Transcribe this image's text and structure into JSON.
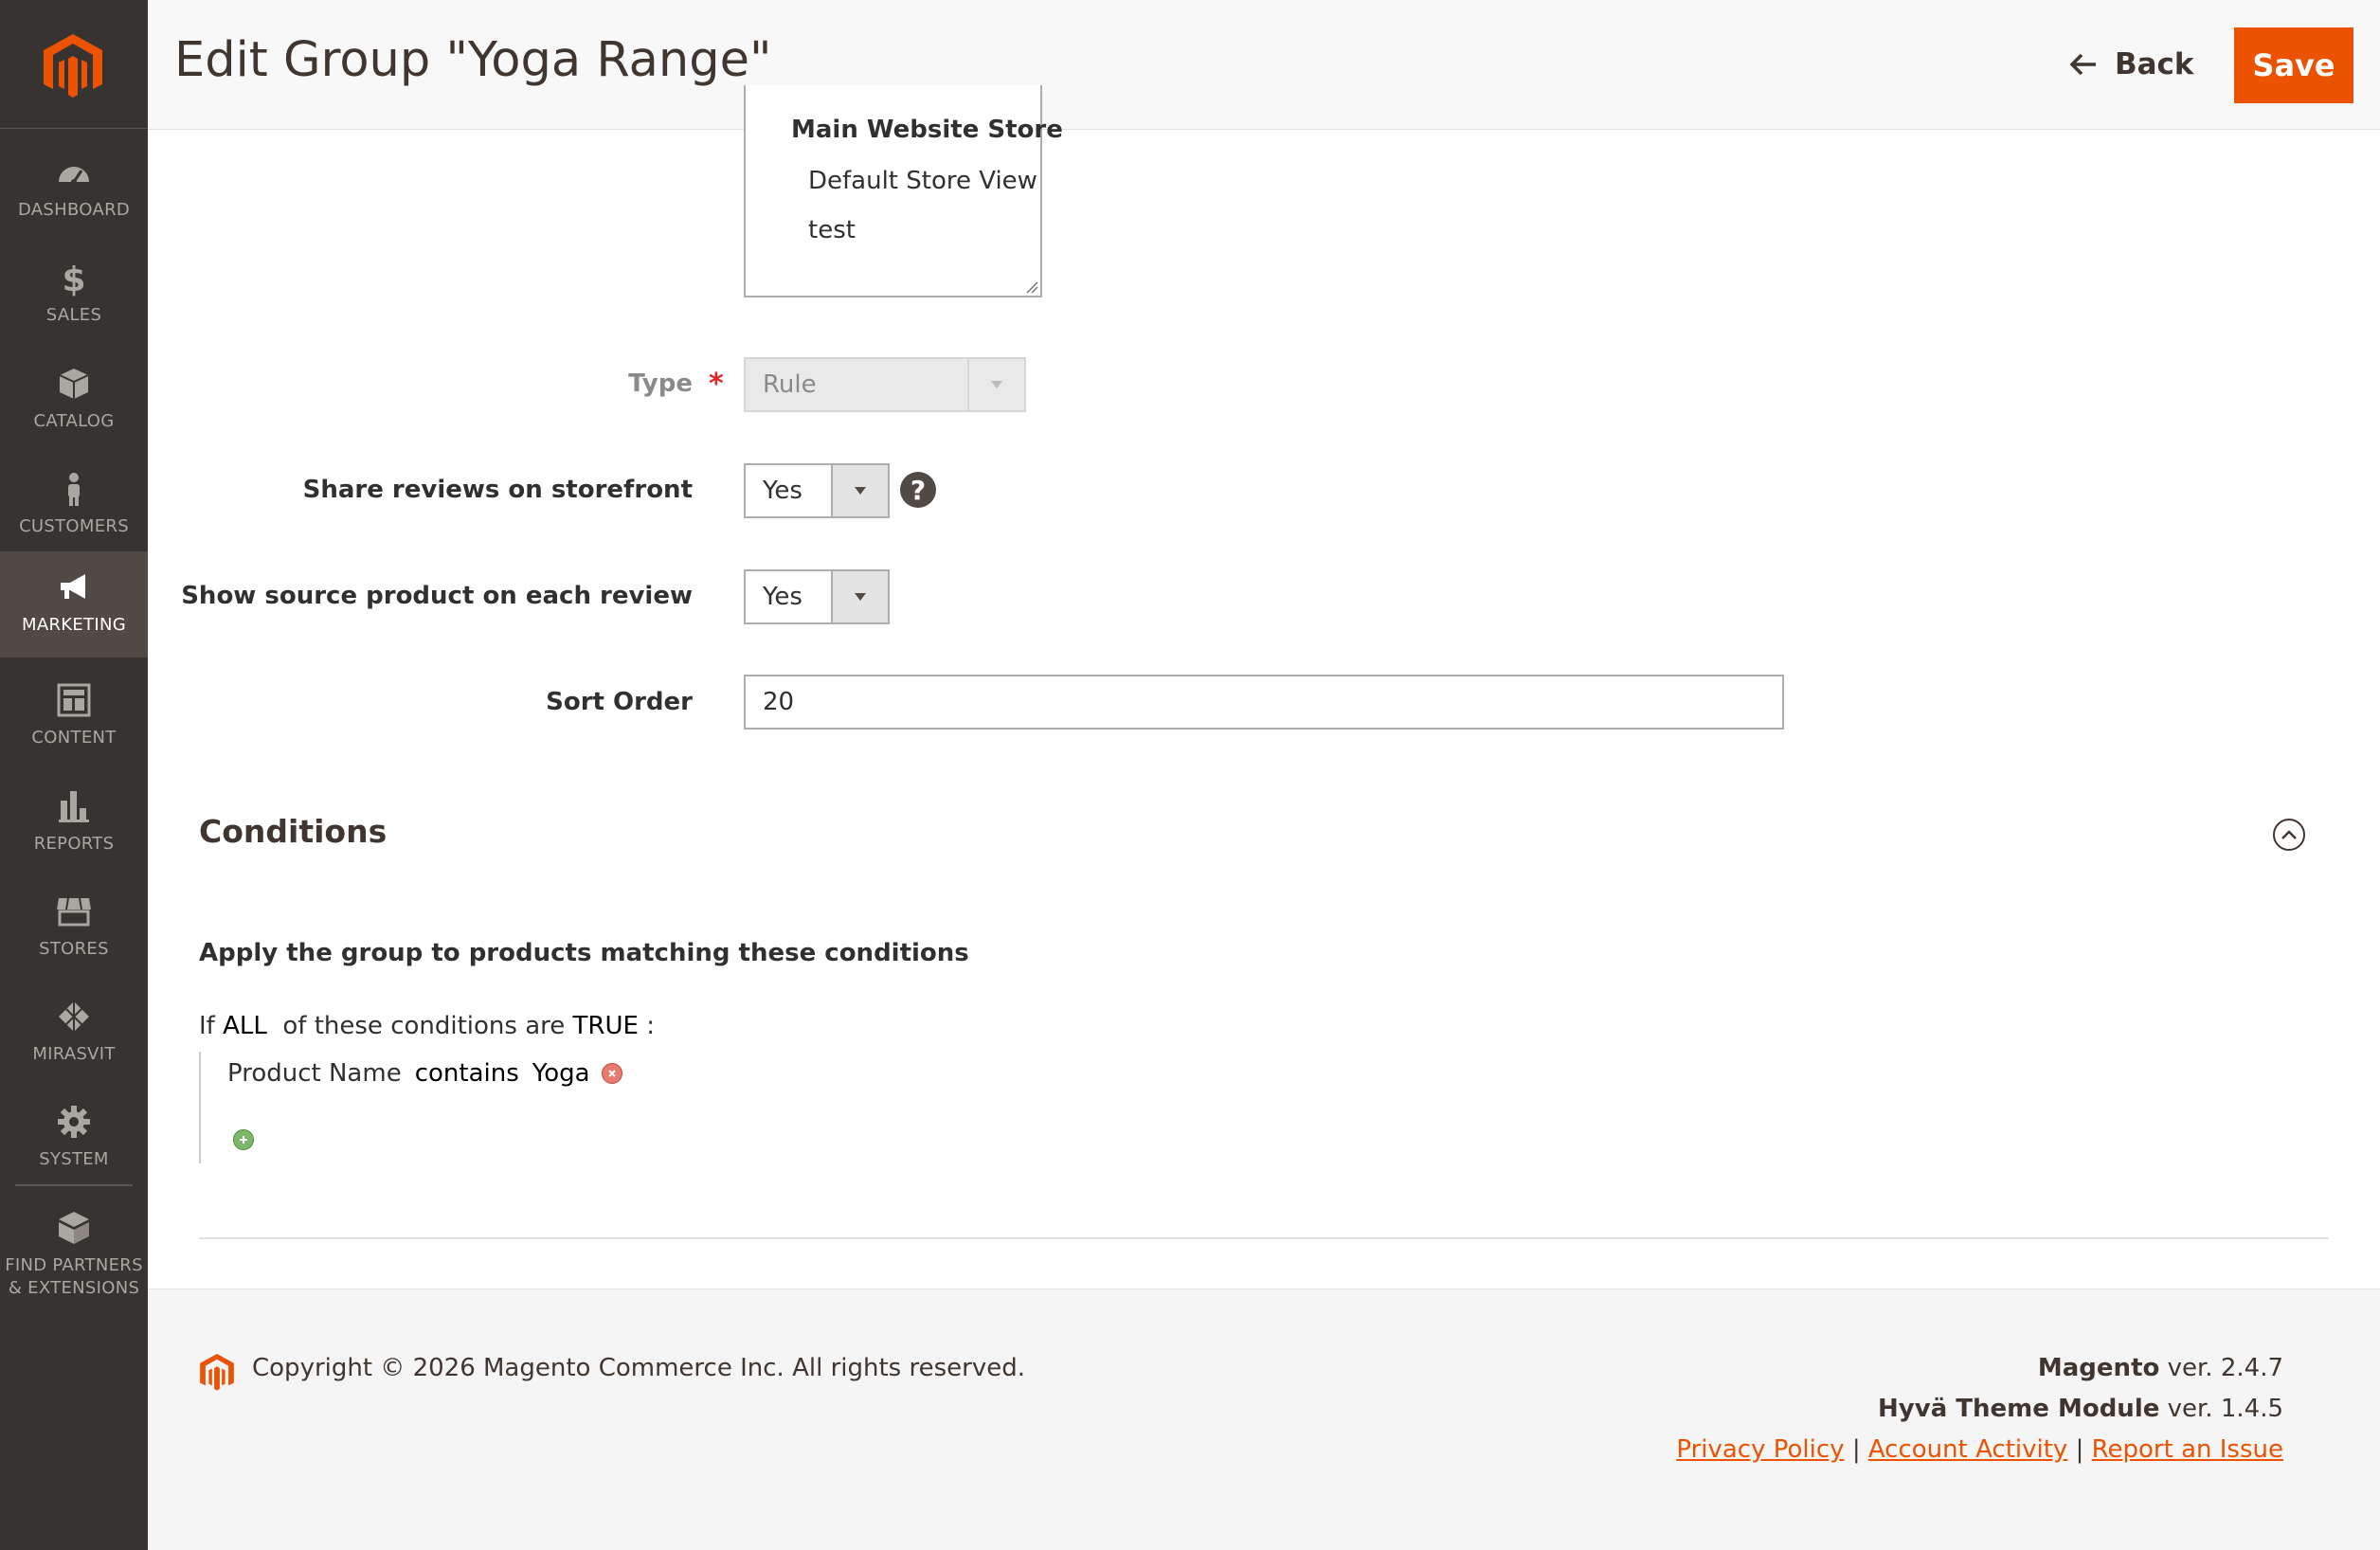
{
  "sidebar": {
    "items": [
      {
        "label": "DASHBOARD",
        "icon": "dashboard-icon"
      },
      {
        "label": "SALES",
        "icon": "dollar-icon"
      },
      {
        "label": "CATALOG",
        "icon": "box-icon"
      },
      {
        "label": "CUSTOMERS",
        "icon": "person-icon"
      },
      {
        "label": "MARKETING",
        "icon": "megaphone-icon",
        "active": true
      },
      {
        "label": "CONTENT",
        "icon": "layout-icon"
      },
      {
        "label": "REPORTS",
        "icon": "bar-chart-icon"
      },
      {
        "label": "STORES",
        "icon": "store-icon"
      },
      {
        "label": "MIRASVIT",
        "icon": "mirasvit-icon"
      },
      {
        "label": "SYSTEM",
        "icon": "gear-icon"
      },
      {
        "label_line1": "FIND PARTNERS",
        "label_line2": "& EXTENSIONS",
        "icon": "blocks-icon"
      }
    ]
  },
  "header": {
    "title": "Edit Group \"Yoga Range\"",
    "back_label": "Back",
    "save_label": "Save"
  },
  "form": {
    "store_view": {
      "group": "Main Website Store",
      "options": [
        "Default Store View",
        "test"
      ]
    },
    "type": {
      "label": "Type",
      "value": "Rule"
    },
    "share_reviews": {
      "label": "Share reviews on storefront",
      "value": "Yes"
    },
    "show_source": {
      "label": "Show source product on each review",
      "value": "Yes"
    },
    "sort_order": {
      "label": "Sort Order",
      "value": "20"
    }
  },
  "conditions": {
    "title": "Conditions",
    "heading": "Apply the group to products matching these conditions",
    "if_text": "If",
    "aggregator": "ALL",
    "middle_text": "of these conditions are",
    "value": "TRUE",
    "colon": ":",
    "rule": {
      "attribute": "Product Name",
      "operator": "contains",
      "value": "Yoga"
    }
  },
  "footer": {
    "copyright": "Copyright © 2026 Magento Commerce Inc. All rights reserved.",
    "magento_name": "Magento",
    "magento_ver": "ver. 2.4.7",
    "hyva_name": "Hyvä Theme Module",
    "hyva_ver": "ver. 1.4.5",
    "privacy": "Privacy Policy",
    "account": " Account Activity",
    "report": "Report an Issue",
    "sep": "|"
  },
  "colors": {
    "accent": "#eb5202",
    "sidebar": "#373330",
    "sidebar_active": "#514943"
  }
}
